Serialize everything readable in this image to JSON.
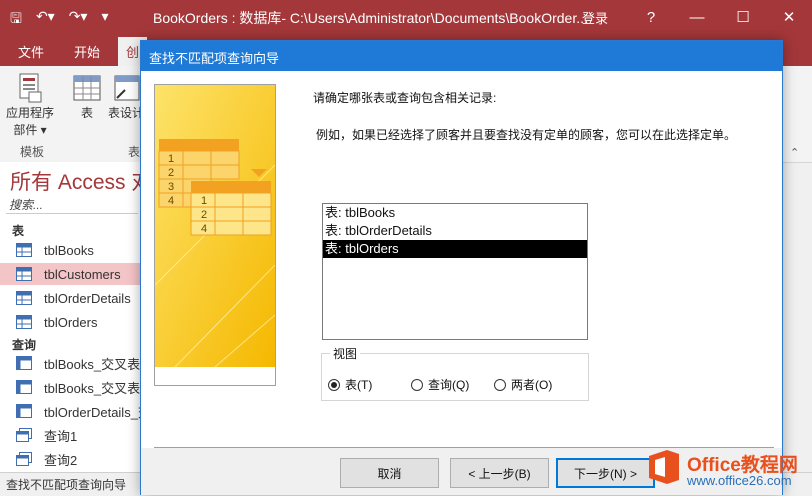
{
  "app": {
    "title": "BookOrders : 数据库- C:\\Users\\Administrator\\Documents\\BookOrder...",
    "login": "登录",
    "accent": "#a4373a"
  },
  "ribbon": {
    "tabs": [
      "文件",
      "开始",
      "创"
    ],
    "buttons": {
      "app_parts_line1": "应用程序",
      "app_parts_line2": "部件 ▾",
      "table": "表",
      "table_design": "表设计"
    },
    "groups": {
      "templates": "模板",
      "tables": "表"
    }
  },
  "nav": {
    "title": "所有 Access 对",
    "search_placeholder": "搜索...",
    "tables_header": "表",
    "tables": [
      "tblBooks",
      "tblCustomers",
      "tblOrderDetails",
      "tblOrders"
    ],
    "queries_header": "查询",
    "queries": [
      "tblBooks_交叉表",
      "tblBooks_交叉表",
      "tblOrderDetails_交",
      "查询1",
      "查询2"
    ]
  },
  "status": {
    "text": "查找不匹配项查询向导"
  },
  "dialog": {
    "title": "查找不匹配项查询向导",
    "prompt": "请确定哪张表或查询包含相关记录:",
    "example": "例如，如果已经选择了顾客并且要查找没有定单的顾客，您可以在此选择定单。",
    "list_items": [
      "表: tblBooks",
      "表: tblOrderDetails",
      "表: tblOrders"
    ],
    "view_label": "视图",
    "radios": [
      "表(T)",
      "查询(Q)",
      "两者(O)"
    ],
    "buttons": {
      "cancel": "取消",
      "back": "< 上一步(B)",
      "next": "下一步(N) >"
    }
  },
  "watermark": {
    "brand": "Office教程网",
    "url": "www.office26.com"
  }
}
